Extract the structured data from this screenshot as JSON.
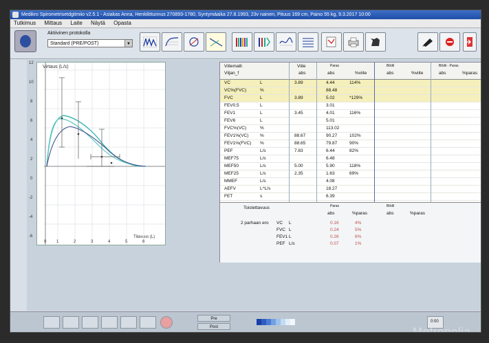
{
  "window": {
    "title": "Medikro Spirometrisetdgitmiio v2.5.1 - Asiakas Anna, Henkilötunnus 270893-1780, Syntymäaika 27.8.1993, 23v nainen, Pituus 169 cm, Paino 55 kg, 9.3.2017 10:00"
  },
  "menu": [
    "Tutkimus",
    "Mittaus",
    "Laite",
    "Näytä",
    "Opasta"
  ],
  "protocol": {
    "label": "Aktiivinen protokolla",
    "value": "Standard (PRE/POST)"
  },
  "graph": {
    "ylabel": "Virtaus (L/s)",
    "xlabel": "Tilavuus (L)",
    "yticks": [
      "12",
      "10",
      "8",
      "6",
      "4",
      "2",
      "0",
      "-2",
      "-4",
      "-6",
      "-8"
    ],
    "xticks": [
      "0",
      "1",
      "2",
      "3",
      "4",
      "5",
      "6"
    ]
  },
  "table": {
    "header": {
      "param": "Viitemalli",
      "model": "Viljan_f",
      "ref": "Viite",
      "ref_sub": "abs",
      "pre": "Paras",
      "pre_abs": "abs",
      "pre_pct": "%viite",
      "post": "Bt/dil",
      "post_abs": "abs",
      "post_pct": "%viite",
      "diff": "Bt/dil - Paras",
      "diff_abs": "abs",
      "diff_pct": "%paras"
    },
    "rows": [
      {
        "name": "VC",
        "unit": "L",
        "ref": "3.89",
        "abs": "4.44",
        "pct": "114%",
        "hl": true
      },
      {
        "name": "VC%(FVC)",
        "unit": "%",
        "ref": "",
        "abs": "88.48",
        "pct": "",
        "hl": true
      },
      {
        "name": "FVC",
        "unit": "L",
        "ref": "3.89",
        "abs": "5.02",
        "pct": "*129%",
        "hl": true
      },
      {
        "name": "FEV0.5",
        "unit": "L",
        "ref": "",
        "abs": "3.01",
        "pct": "",
        "hl": false
      },
      {
        "name": "FEV1",
        "unit": "L",
        "ref": "3.45",
        "abs": "4.01",
        "pct": "116%",
        "hl": false
      },
      {
        "name": "FEV6",
        "unit": "L",
        "ref": "",
        "abs": "5.01",
        "pct": "",
        "hl": false
      },
      {
        "name": "FVC%(VC)",
        "unit": "%",
        "ref": "",
        "abs": "113.02",
        "pct": "",
        "hl": false
      },
      {
        "name": "FEV1%(VC)",
        "unit": "%",
        "ref": "88.67",
        "abs": "90.27",
        "pct": "102%",
        "hl": false
      },
      {
        "name": "FEV1%(FVC)",
        "unit": "%",
        "ref": "88.65",
        "abs": "79.87",
        "pct": "90%",
        "hl": false
      },
      {
        "name": "PEF",
        "unit": "L/s",
        "ref": "7.83",
        "abs": "6.44",
        "pct": "82%",
        "hl": false
      },
      {
        "name": "MEF75",
        "unit": "L/s",
        "ref": "",
        "abs": "6.48",
        "pct": "",
        "hl": false
      },
      {
        "name": "MEF50",
        "unit": "L/s",
        "ref": "5.00",
        "abs": "5.90",
        "pct": "118%",
        "hl": false
      },
      {
        "name": "MEF25",
        "unit": "L/s",
        "ref": "2.35",
        "abs": "1.63",
        "pct": "69%",
        "hl": false
      },
      {
        "name": "MMEF",
        "unit": "L/s",
        "ref": "",
        "abs": "4.08",
        "pct": "",
        "hl": false
      },
      {
        "name": "AEFV",
        "unit": "L^L/s",
        "ref": "",
        "abs": "18.27",
        "pct": "",
        "hl": false
      },
      {
        "name": "FET",
        "unit": "s",
        "ref": "",
        "abs": "6.39",
        "pct": "",
        "hl": false
      }
    ]
  },
  "summary": {
    "title": "Toistettavuus",
    "pre": "Paras",
    "pre_abs": "abs",
    "pre_pct": "%paras",
    "post": "Bt/dil",
    "post_abs": "abs",
    "post_pct": "%paras",
    "group": "2 parhaan ero",
    "rows": [
      {
        "name": "VC",
        "unit": "L",
        "abs": "0.16",
        "pct": "4%"
      },
      {
        "name": "FVC",
        "unit": "L",
        "abs": "0.24",
        "pct": "5%"
      },
      {
        "name": "FEV1",
        "unit": "L",
        "abs": "0.26",
        "pct": "6%"
      },
      {
        "name": "PEF",
        "unit": "L/s",
        "abs": "0.07",
        "pct": "1%"
      }
    ]
  },
  "statusbar": {
    "pre": "Pre",
    "post": "Post",
    "time": "0:00",
    "watermark": "Metropolia"
  },
  "colors": {
    "accent": "#1f4ea8",
    "highlight": "#f5f0bb",
    "curve": "#3fb8b4"
  }
}
